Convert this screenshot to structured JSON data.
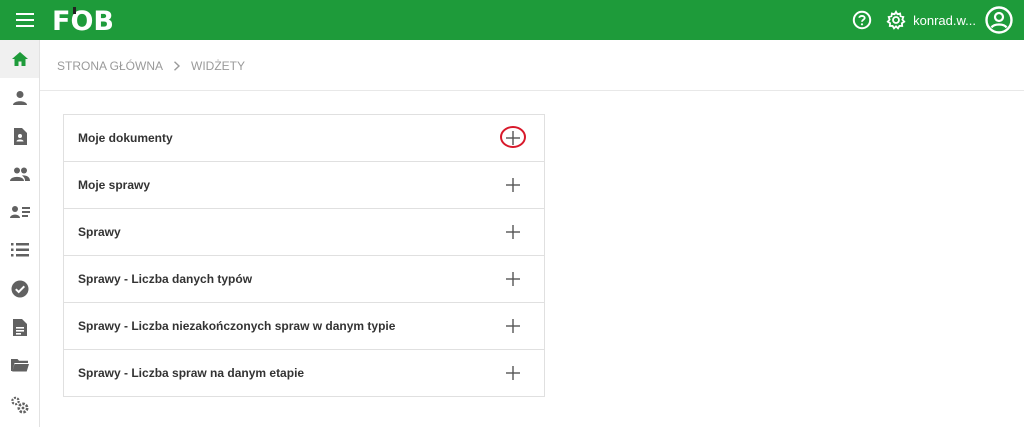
{
  "header": {
    "logo_text": "FOB",
    "username": "konrad.w...",
    "icons": [
      "menu-icon",
      "help-icon",
      "gear-icon",
      "account-icon"
    ]
  },
  "sidebar": {
    "items": [
      {
        "name": "home",
        "icon": "home-icon",
        "active": true
      },
      {
        "name": "user",
        "icon": "person-icon"
      },
      {
        "name": "contact-doc",
        "icon": "contact-document-icon"
      },
      {
        "name": "groups",
        "icon": "people-icon"
      },
      {
        "name": "user-list",
        "icon": "person-list-icon"
      },
      {
        "name": "list",
        "icon": "list-icon"
      },
      {
        "name": "tasks",
        "icon": "check-circle-icon"
      },
      {
        "name": "documents",
        "icon": "document-icon"
      },
      {
        "name": "folders",
        "icon": "folder-icon"
      },
      {
        "name": "settings",
        "icon": "cogs-icon"
      }
    ]
  },
  "breadcrumb": {
    "home": "STRONA GŁÓWNA",
    "current": "WIDŻETY"
  },
  "widgets": [
    {
      "label": "Moje dokumenty",
      "highlighted": true
    },
    {
      "label": "Moje sprawy"
    },
    {
      "label": "Sprawy"
    },
    {
      "label": "Sprawy - Liczba danych typów"
    },
    {
      "label": "Sprawy - Liczba niezakończonych spraw w danym typie"
    },
    {
      "label": "Sprawy - Liczba spraw na danym etapie"
    }
  ],
  "colors": {
    "brand_green": "#1e9b3a",
    "highlight_red": "#d8192b",
    "icon_gray": "#616161",
    "active_icon": "#1e9b3a"
  }
}
